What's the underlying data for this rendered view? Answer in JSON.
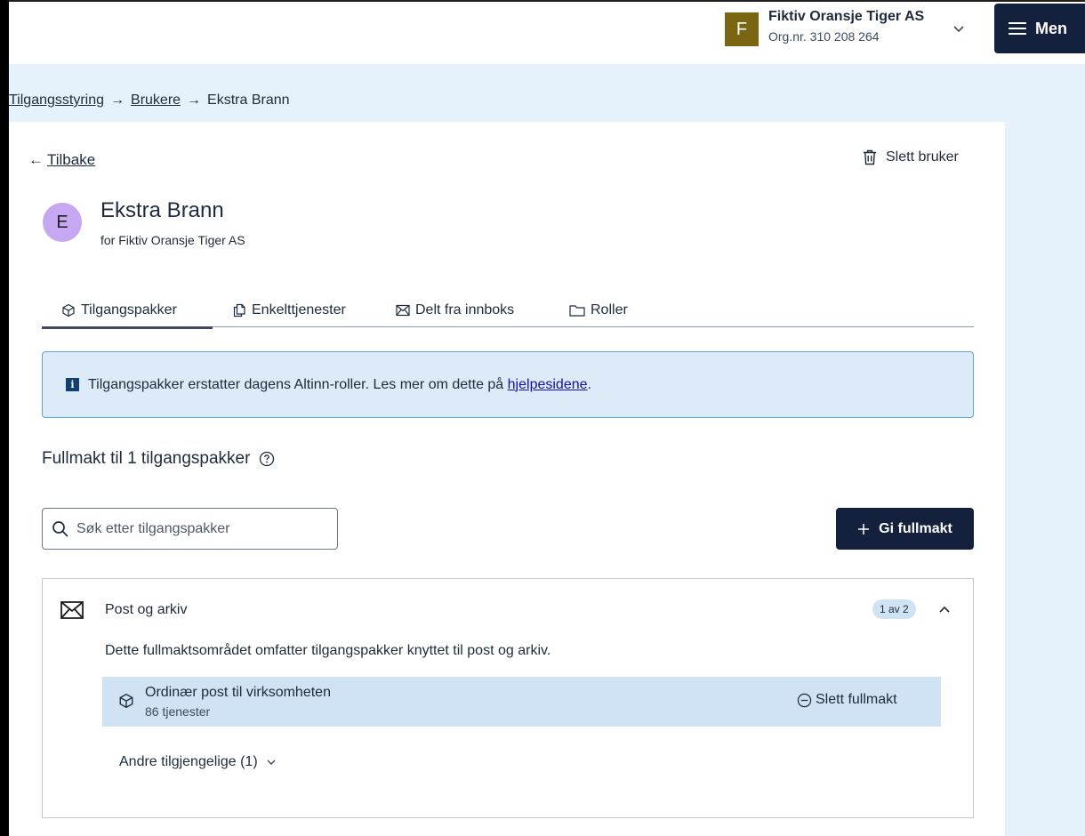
{
  "org": {
    "avatar_letter": "F",
    "avatar_color": "#7a6512",
    "name": "Fiktiv Oransje Tiger AS",
    "number": "Org.nr. 310 208 264"
  },
  "menu": {
    "label": "Men",
    "icon": "menu-icon"
  },
  "breadcrumb": {
    "items": [
      "Tilgangsstyring",
      "Brukere",
      "Ekstra Brann"
    ],
    "separator": "→"
  },
  "back": {
    "arrow": "←",
    "label": "Tilbake"
  },
  "delete_user": {
    "label": "Slett bruker",
    "icon": "trash-icon"
  },
  "user": {
    "avatar_letter": "E",
    "avatar_color": "#c6a7f2",
    "name": "Ekstra Brann",
    "subtitle": "for Fiktiv Oransje Tiger AS"
  },
  "tabs": [
    {
      "label": "Tilgangspakker",
      "icon": "package-icon",
      "active": true
    },
    {
      "label": "Enkelttjenester",
      "icon": "copy-icon",
      "active": false
    },
    {
      "label": "Delt fra innboks",
      "icon": "envelope-icon",
      "active": false
    },
    {
      "label": "Roller",
      "icon": "folder-icon",
      "active": false
    }
  ],
  "info": {
    "text": "Tilgangspakker erstatter dagens Altinn-roller. Les mer om dette på ",
    "link": "hjelpesidene",
    "suffix": "."
  },
  "section": {
    "heading": "Fullmakt til 1 tilgangspakker"
  },
  "search": {
    "placeholder": "Søk etter tilgangspakker",
    "value": ""
  },
  "give_button": {
    "label": "Gi fullmakt"
  },
  "area": {
    "title": "Post og arkiv",
    "badge": "1 av 2",
    "description": "Dette fullmaktsområdet omfatter tilgangspakker knyttet til post og arkiv.",
    "package": {
      "title": "Ordinær post til virksomheten",
      "subtitle": "86 tjenester",
      "delete_label": "Slett fullmakt"
    },
    "other_available": "Andre tilgjengelige (1)"
  },
  "colors": {
    "primary_dark": "#13213d",
    "page_background": "#e6f2fb",
    "info_background": "#dcebf7",
    "package_highlight": "#cfe3f5"
  }
}
